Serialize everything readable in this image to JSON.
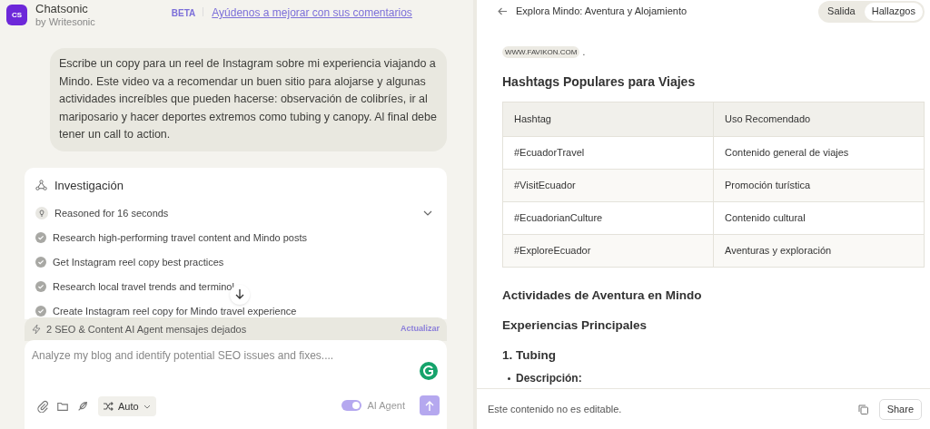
{
  "app": {
    "logo": "CS",
    "name": "Chatsonic",
    "by": "by Writesonic",
    "beta": "BETA",
    "feedback_link": "Ayúdenos a mejorar con sus comentarios"
  },
  "user_message": "Escribe un copy para un reel de Instagram sobre mi experiencia viajando a Mindo. Este video va a recomendar un buen sitio para alojarse y algunas actividades increíbles que pueden hacerse: observación de colibríes, ir al mariposario y hacer deportes extremos como tubing y canopy. Al final debe tener un call to action.",
  "research": {
    "title": "Investigación",
    "reasoning": {
      "label": "Reasoned for 16 seconds",
      "expanded": false
    },
    "steps": [
      {
        "label": "Research high-performing travel content and Mindo posts",
        "done": true
      },
      {
        "label": "Get Instagram reel copy best practices",
        "done": true
      },
      {
        "label": "Research local travel trends and terminol",
        "done": true
      },
      {
        "label": "Create Instagram reel copy for Mindo travel experience",
        "done": true
      }
    ]
  },
  "notice": {
    "text": "2 SEO & Content AI Agent mensajes dejados",
    "action": "Actualizar"
  },
  "composer": {
    "placeholder": "Analyze my blog and identify potential SEO issues and fixes....",
    "mode": "Auto",
    "agent_label": "AI Agent",
    "agent_on": true
  },
  "panel": {
    "title": "Explora Mindo: Aventura y Alojamiento",
    "tabs": [
      {
        "label": "Salida",
        "selected": false
      },
      {
        "label": "Hallazgos",
        "selected": true
      }
    ],
    "source_chip": "WWW.FAVIKON.COM",
    "source_dot": ".",
    "heading": "Hashtags Populares para Viajes",
    "table": {
      "columns": [
        "Hashtag",
        "Uso Recomendado"
      ],
      "rows": [
        [
          "#EcuadorTravel",
          "Contenido general de viajes"
        ],
        [
          "#VisitEcuador",
          "Promoción turística"
        ],
        [
          "#EcuadorianCulture",
          "Contenido cultural"
        ],
        [
          "#ExploreEcuador",
          "Aventuras y exploración"
        ]
      ]
    },
    "sections": [
      {
        "kind": "h2",
        "text": "Actividades de Aventura en Mindo"
      },
      {
        "kind": "h3",
        "text": "Experiencias Principales"
      },
      {
        "kind": "h3",
        "text": "1. Tubing"
      },
      {
        "kind": "bullet",
        "text": "Descripción:"
      }
    ],
    "footer": {
      "note": "Este contenido no es editable.",
      "share": "Share"
    }
  }
}
